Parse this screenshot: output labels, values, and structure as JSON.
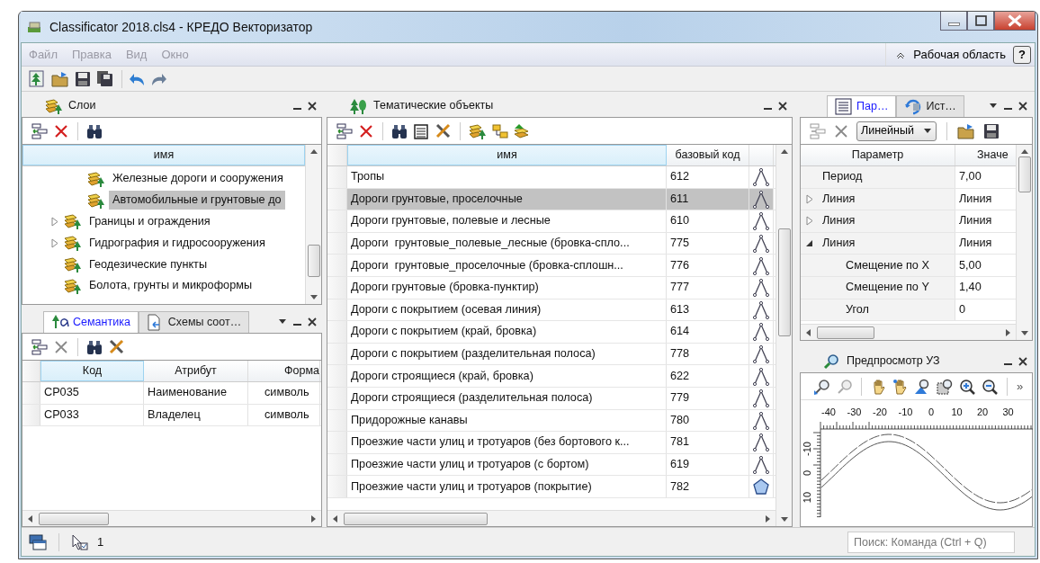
{
  "window": {
    "title": "Classificator 2018.cls4 - КРЕДО Векторизатор"
  },
  "menu": {
    "items": [
      {
        "label": "Файл",
        "disabled": true
      },
      {
        "label": "Правка",
        "disabled": true
      },
      {
        "label": "Вид",
        "disabled": true
      },
      {
        "label": "Окно",
        "disabled": true
      }
    ],
    "workspace": "Рабочая область",
    "help": "?"
  },
  "layers": {
    "title": "Слои",
    "column": "имя",
    "tree": [
      {
        "children": [
          {
            "label": "Железные дороги и сооружения",
            "selected": false
          },
          {
            "label": "Автомобильные и грунтовые до",
            "selected": true
          }
        ]
      },
      {
        "label": "Границы и ограждения",
        "expanded": false,
        "selected": false
      },
      {
        "label": "Гидрография и гидросооружения",
        "expanded": false,
        "selected": false
      },
      {
        "label": "Геодезические пункты",
        "selected": false
      },
      {
        "label": "Болота, грунты и микроформы",
        "selected": false
      }
    ]
  },
  "semantics": {
    "tabs": [
      {
        "label": "Семантика",
        "selected": true
      },
      {
        "label": "Схемы соот…",
        "selected": false
      }
    ],
    "columns": [
      "Код",
      "Атрибут",
      "Форма"
    ],
    "rows": [
      [
        "CP035",
        "Наименование",
        "символь"
      ],
      [
        "CP033",
        "Владелец",
        "символь"
      ]
    ]
  },
  "objects": {
    "title": "Тематические объекты",
    "columns": [
      "имя",
      "базовый код"
    ],
    "rows": [
      {
        "name": "Тропы",
        "code": "612",
        "kind": "line",
        "selected": false
      },
      {
        "name": "Дороги грунтовые, проселочные",
        "code": "611",
        "kind": "line",
        "selected": true
      },
      {
        "name": "Дороги грунтовые, полевые и лесные",
        "code": "610",
        "kind": "line",
        "selected": false
      },
      {
        "name": "Дороги  грунтовые_полевые_лесные (бровка-спло...",
        "code": "775",
        "kind": "line",
        "selected": false
      },
      {
        "name": "Дороги  грунтовые_проселочные (бровка-сплошн...",
        "code": "776",
        "kind": "line",
        "selected": false
      },
      {
        "name": "Дороги грунтовые (бровка-пунктир)",
        "code": "777",
        "kind": "line",
        "selected": false
      },
      {
        "name": "Дороги с покрытием (осевая линия)",
        "code": "613",
        "kind": "line",
        "selected": false
      },
      {
        "name": "Дороги с покрытием (край, бровка)",
        "code": "614",
        "kind": "line",
        "selected": false
      },
      {
        "name": "Дороги с покрытием (разделительная полоса)",
        "code": "778",
        "kind": "line",
        "selected": false
      },
      {
        "name": "Дороги строящиеся (край, бровка)",
        "code": "622",
        "kind": "line",
        "selected": false
      },
      {
        "name": "Дороги строящиеся (разделительная полоса)",
        "code": "779",
        "kind": "line",
        "selected": false
      },
      {
        "name": "Придорожные канавы",
        "code": "780",
        "kind": "line",
        "selected": false
      },
      {
        "name": "Проезжие части улиц и тротуаров (без бортового к...",
        "code": "781",
        "kind": "line",
        "selected": false
      },
      {
        "name": "Проезжие части улиц и тротуаров (с бортом)",
        "code": "619",
        "kind": "line",
        "selected": false
      },
      {
        "name": "Проезжие части улиц и тротуаров (покрытие)",
        "code": "782",
        "kind": "polygon",
        "selected": false
      }
    ]
  },
  "params": {
    "tabs": [
      {
        "label": "Пар…",
        "selected": true
      },
      {
        "label": "Ист…",
        "selected": false
      }
    ],
    "mode": "Линейный",
    "columns": [
      "Параметр",
      "Значе"
    ],
    "rows": [
      {
        "name": "Период",
        "value": "7,00"
      },
      {
        "name": "Линия",
        "value": "Линия",
        "expanded": false
      },
      {
        "name": "Линия",
        "value": "Линия",
        "expanded": false
      },
      {
        "name": "Линия",
        "value": "Линия",
        "expanded": true,
        "children": [
          {
            "name": "Смещение по X",
            "value": "5,00"
          },
          {
            "name": "Смещение по Y",
            "value": "1,40"
          },
          {
            "name": "Угол",
            "value": "0"
          }
        ]
      }
    ]
  },
  "preview": {
    "title": "Предпросмотр УЗ",
    "more": "»",
    "x_labels": [
      "-40",
      "-30",
      "-20",
      "-10",
      "0",
      "10",
      "20",
      "30"
    ],
    "y_labels": [
      "-10",
      "0",
      "10"
    ]
  },
  "status_bar": {
    "selected_count": "1",
    "search_placeholder": "Поиск: Команда (Ctrl + Q)"
  }
}
